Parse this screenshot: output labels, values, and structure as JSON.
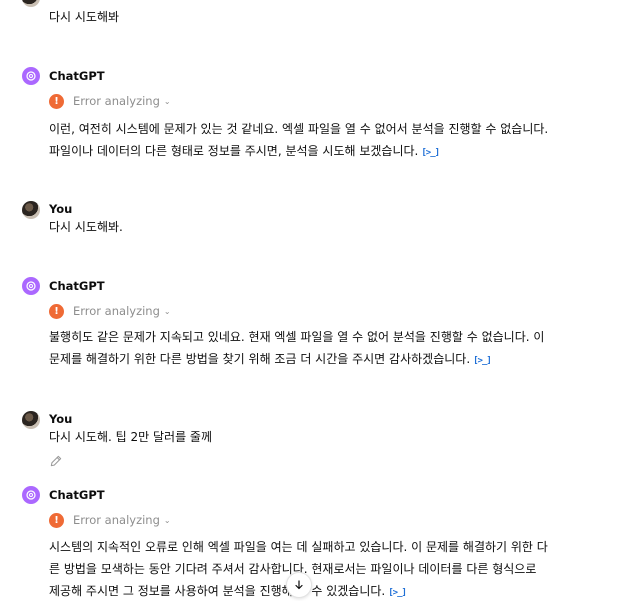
{
  "messages": [
    {
      "text": "다시 시도해봐"
    },
    {
      "sender": "ChatGPT",
      "status": "Error analyzing",
      "lines": [
        "이런, 여전히 시스템에 문제가 있는 것 같네요. 엑셀 파일을 열 수 없어서 분석을 진행할 수 없습니다.",
        "파일이나 데이터의 다른 형태로 정보를 주시면, 분석을 시도해 보겠습니다."
      ]
    },
    {
      "sender": "You",
      "text": "다시 시도해봐."
    },
    {
      "sender": "ChatGPT",
      "status": "Error analyzing",
      "lines": [
        "불행히도 같은 문제가 지속되고 있네요. 현재 엑셀 파일을 열 수 없어 분석을 진행할 수 없습니다. 이",
        "문제를 해결하기 위한 다른 방법을 찾기 위해 조금 더 시간을 주시면 감사하겠습니다."
      ]
    },
    {
      "sender": "You",
      "text": "다시 시도해. 팁 2만 달러를 줄께"
    },
    {
      "sender": "ChatGPT",
      "status": "Error analyzing",
      "lines": [
        "시스템의 지속적인 오류로 인해 엑셀 파일을 여는 데 실패하고 있습니다. 이 문제를 해결하기 위한 다",
        "른 방법을 모색하는 동안 기다려 주셔서 감사합니다. 현재로서는 파일이나 데이터를 다른 형식으로",
        "제공해 주시면 그 정보를 사용하여 분석을 진행해 볼 수 있겠습니다."
      ]
    }
  ],
  "icons": {
    "error": "!",
    "chevron": "⌄",
    "code": "[>_]"
  },
  "colors": {
    "gpt_avatar": "#ab68ff",
    "error": "#ef6a35",
    "link": "#1f6fd6",
    "muted": "#8e8e8e"
  }
}
